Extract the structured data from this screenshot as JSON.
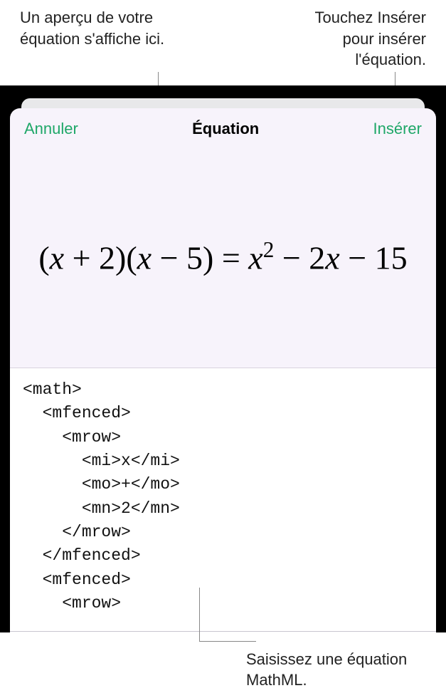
{
  "callouts": {
    "preview": "Un aperçu de votre équation s'affiche ici.",
    "insert": "Touchez Insérer pour insérer l'équation.",
    "mathml": "Saisissez une équation MathML."
  },
  "header": {
    "cancel": "Annuler",
    "title": "Équation",
    "insert": "Insérer"
  },
  "preview": {
    "equation_plain": "(x + 2)(x − 5) = x² − 2x − 15"
  },
  "code": {
    "content": "<math>\n  <mfenced>\n    <mrow>\n      <mi>x</mi>\n      <mo>+</mo>\n      <mn>2</mn>\n    </mrow>\n  </mfenced>\n  <mfenced>\n    <mrow>"
  }
}
